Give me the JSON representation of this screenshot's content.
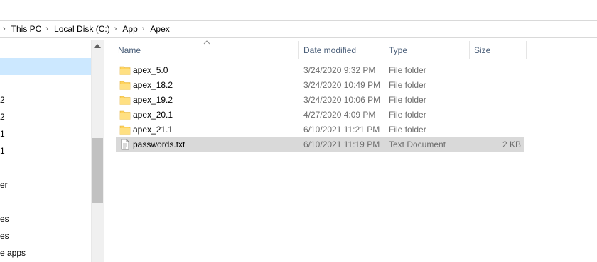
{
  "breadcrumb": {
    "segments": [
      "This PC",
      "Local Disk (C:)",
      "App",
      "Apex"
    ]
  },
  "nav_pane": {
    "items": [
      "2",
      "2",
      "1",
      "1",
      "er",
      "es",
      "es",
      "e apps"
    ]
  },
  "columns": {
    "name": "Name",
    "date_modified": "Date modified",
    "type": "Type",
    "size": "Size"
  },
  "files": [
    {
      "name": "apex_5.0",
      "date": "3/24/2020 9:32 PM",
      "type": "File folder",
      "size": "",
      "icon": "folder-icon"
    },
    {
      "name": "apex_18.2",
      "date": "3/24/2020 10:49 PM",
      "type": "File folder",
      "size": "",
      "icon": "folder-icon"
    },
    {
      "name": "apex_19.2",
      "date": "3/24/2020 10:06 PM",
      "type": "File folder",
      "size": "",
      "icon": "folder-icon"
    },
    {
      "name": "apex_20.1",
      "date": "4/27/2020 4:09 PM",
      "type": "File folder",
      "size": "",
      "icon": "folder-icon"
    },
    {
      "name": "apex_21.1",
      "date": "6/10/2021 11:21 PM",
      "type": "File folder",
      "size": "",
      "icon": "folder-icon"
    },
    {
      "name": "passwords.txt",
      "date": "6/10/2021 11:19 PM",
      "type": "Text Document",
      "size": "2 KB",
      "icon": "text-file-icon",
      "selected": true
    }
  ],
  "colors": {
    "folder": "#ffd35c",
    "selection": "#d9d9d9",
    "header_text": "#4c607a"
  }
}
